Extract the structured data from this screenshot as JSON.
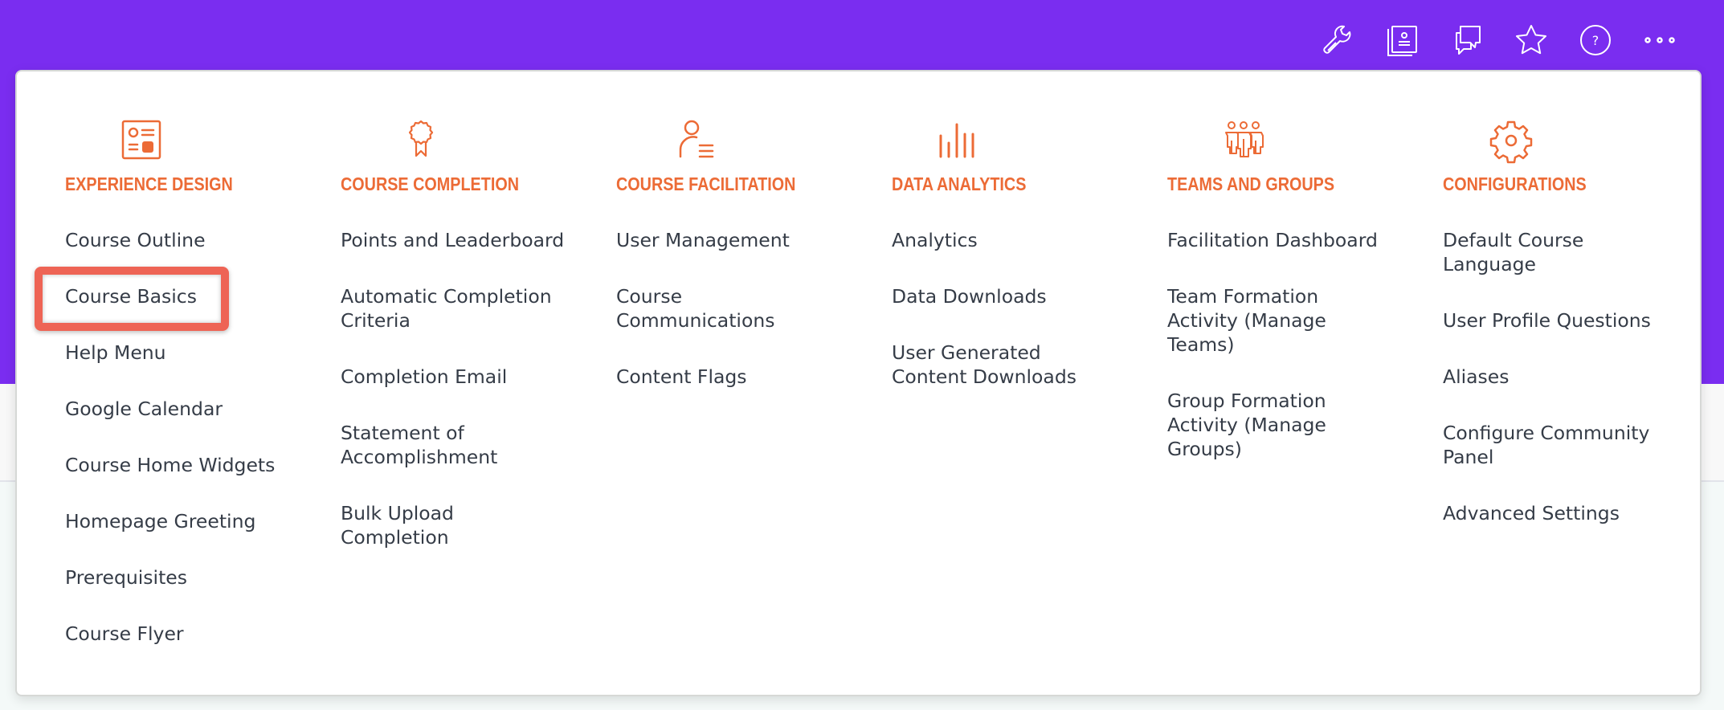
{
  "toolbar": {
    "buttons": [
      {
        "name": "tools",
        "icon": "wrench-icon"
      },
      {
        "name": "catalog",
        "icon": "profile-book-icon"
      },
      {
        "name": "messages",
        "icon": "chat-bubbles-icon"
      },
      {
        "name": "favorites",
        "icon": "star-icon"
      },
      {
        "name": "help",
        "icon": "help-circle-icon",
        "glyph": "?"
      },
      {
        "name": "more",
        "icon": "more-dots-icon"
      }
    ]
  },
  "colors": {
    "header_purple": "#7a2df0",
    "accent_orange": "#ec6b36",
    "item_text": "#353c47",
    "highlight_red": "#ee6455"
  },
  "menu": {
    "columns": [
      {
        "title": "EXPERIENCE DESIGN",
        "icon": "profile-layout-icon",
        "items": [
          "Course Outline",
          "Course Basics",
          "Help Menu",
          "Google Calendar",
          "Course Home Widgets",
          "Homepage Greeting",
          "Prerequisites",
          "Course Flyer"
        ]
      },
      {
        "title": "COURSE COMPLETION",
        "icon": "award-ribbon-icon",
        "items": [
          "Points and Leaderboard",
          "Automatic Completion Criteria",
          "Completion Email",
          "Statement of Accomplishment",
          "Bulk Upload Completion"
        ]
      },
      {
        "title": "COURSE FACILITATION",
        "icon": "user-list-icon",
        "items": [
          "User Management",
          "Course Communications",
          "Content Flags"
        ]
      },
      {
        "title": "DATA ANALYTICS",
        "icon": "bar-chart-icon",
        "items": [
          "Analytics",
          "Data Downloads",
          "User Generated Content Downloads"
        ]
      },
      {
        "title": "TEAMS AND GROUPS",
        "icon": "team-people-icon",
        "items": [
          "Facilitation Dashboard",
          "Team Formation Activity (Manage Teams)",
          "Group Formation Activity (Manage Groups)"
        ]
      },
      {
        "title": "CONFIGURATIONS",
        "icon": "gear-icon",
        "items": [
          "Default Course Language",
          "User Profile Questions",
          "Aliases",
          "Configure Community Panel",
          "Advanced Settings"
        ]
      }
    ],
    "highlighted_item": "Course Basics"
  }
}
